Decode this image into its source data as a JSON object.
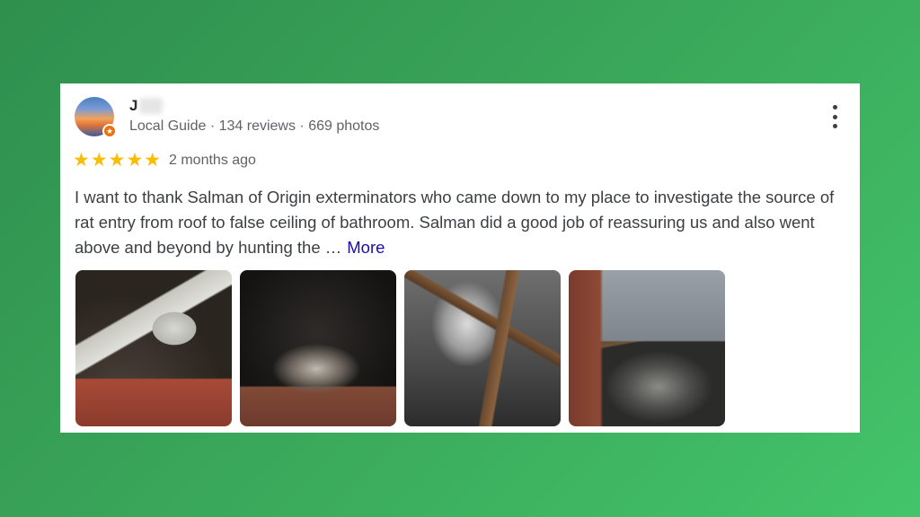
{
  "review": {
    "author_name": "J",
    "author_meta": "Local Guide · 134 reviews · 669 photos",
    "rating_stars": "★★★★★",
    "rating": 5,
    "time_ago": "2 months ago",
    "text": "I want to thank Salman of Origin exterminators who came down to my place to investigate the source of rat entry from roof to false ceiling of bathroom. Salman did a good job of reassuring us and also went above and beyond by hunting the …",
    "more_label": "More",
    "photos_count": 4,
    "colors": {
      "star": "#fbbc04",
      "link": "#1a0dab",
      "badge": "#e8710a"
    }
  }
}
